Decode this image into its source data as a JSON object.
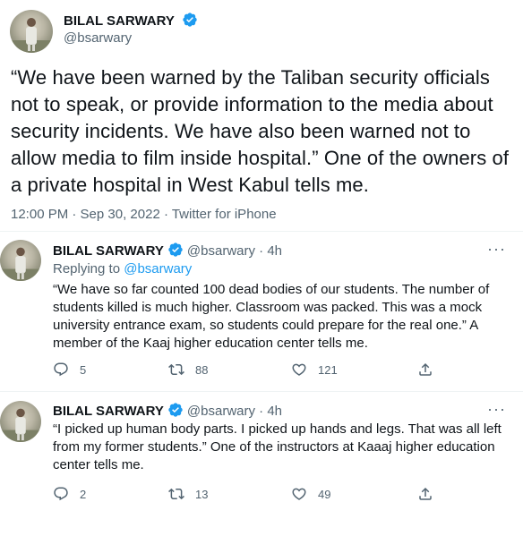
{
  "main_tweet": {
    "author_name": "BILAL SARWARY",
    "handle": "@bsarwary",
    "text": "“We have been warned by the Taliban security officials not to speak, or provide information to the media about security incidents. We have also been warned not to allow media to film inside hospital.” One of the owners of a private hospital in West Kabul tells me.",
    "timestamp": "12:00 PM · Sep 30, 2022 · Twitter for iPhone"
  },
  "replies": [
    {
      "author_name": "BILAL SARWARY",
      "handle": "@bsarwary · 4h",
      "replying_prefix": "Replying to",
      "replying_to": "@bsarwary",
      "text": "“We have so far counted 100 dead bodies of our students. The number of students killed is much higher. Classroom was packed. This was a mock university entrance exam, so students could prepare for the real one.” A member of the Kaaj higher education center tells me.",
      "replies_count": "5",
      "retweets_count": "88",
      "likes_count": "121"
    },
    {
      "author_name": "BILAL SARWARY",
      "handle": "@bsarwary · 4h",
      "text": "“I picked up human body parts. I picked up hands and legs. That was all left from my former students.” One of the instructors at Kaaaj higher education center tells me.",
      "replies_count": "2",
      "retweets_count": "13",
      "likes_count": "49"
    }
  ],
  "more_glyph": "···",
  "colors": {
    "verified": "#1d9bf0",
    "text_primary": "#0f1419",
    "text_secondary": "#536471",
    "link": "#1d9bf0",
    "divider": "#eff3f4"
  },
  "icons": [
    "verified-badge-icon",
    "reply-icon",
    "retweet-icon",
    "like-icon",
    "share-icon",
    "more-icon"
  ]
}
